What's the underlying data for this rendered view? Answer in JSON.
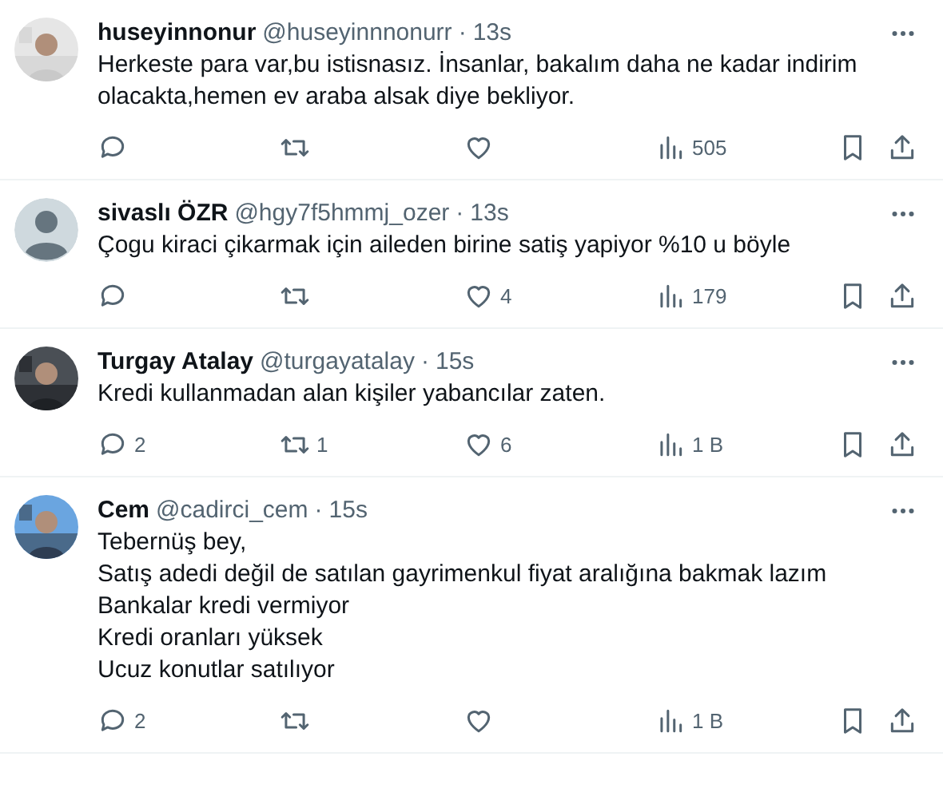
{
  "tweets": [
    {
      "name": "huseyinnonur",
      "handle": "@huseyinnnonurr",
      "separator": "·",
      "time": "13s",
      "lines": [
        "Herkeste para var,bu istisnasız. İnsanlar, bakalım daha ne kadar indirim olacakta,hemen ev araba alsak diye bekliyor."
      ],
      "views": "505"
    },
    {
      "avatar": {
        "kind": "default"
      },
      "name": "sivaslı ÖZR",
      "handle": "@hgy7f5hmmj_ozer",
      "separator": "·",
      "time": "13s",
      "lines": [
        "Çogu kiraci çikarmak için aileden birine satiş yapiyor %10 u böyle"
      ],
      "likes": "4",
      "views": "179"
    },
    {
      "name": "Turgay Atalay",
      "handle": "@turgayatalay",
      "separator": "·",
      "time": "15s",
      "lines": [
        "Kredi kullanmadan alan kişiler yabancılar zaten."
      ],
      "replies": "2",
      "reposts": "1",
      "likes": "6",
      "views": "1 B"
    },
    {
      "name": "Cem",
      "handle": "@cadirci_cem",
      "separator": "·",
      "time": "15s",
      "lines": [
        "Tebernüş bey,",
        "Satış adedi değil de satılan gayrimenkul fiyat aralığına bakmak lazım",
        "Bankalar kredi vermiyor",
        "Kredi oranları yüksek",
        "Ucuz konutlar satılıyor"
      ],
      "replies": "2",
      "views": "1 B"
    }
  ]
}
